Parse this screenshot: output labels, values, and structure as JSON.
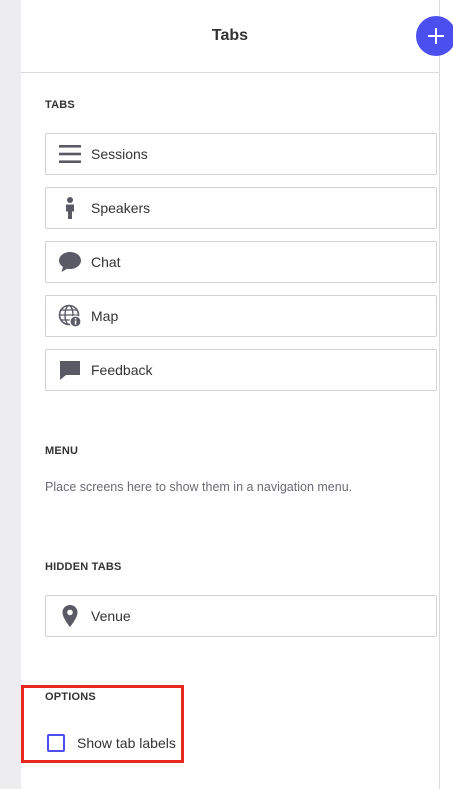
{
  "header": {
    "title": "Tabs"
  },
  "sections": {
    "tabs_label": "TABS",
    "menu_label": "MENU",
    "menu_hint": "Place screens here to show them in a navigation menu.",
    "hidden_label": "HIDDEN TABS",
    "options_label": "OPTIONS"
  },
  "tabs": [
    {
      "label": "Sessions",
      "icon": "list-icon"
    },
    {
      "label": "Speakers",
      "icon": "person-icon"
    },
    {
      "label": "Chat",
      "icon": "chat-bubble-icon"
    },
    {
      "label": "Map",
      "icon": "globe-info-icon"
    },
    {
      "label": "Feedback",
      "icon": "feedback-icon"
    }
  ],
  "hidden_tabs": [
    {
      "label": "Venue",
      "icon": "location-pin-icon"
    }
  ],
  "options": {
    "show_tab_labels": "Show tab labels",
    "show_tab_labels_checked": false
  },
  "colors": {
    "accent": "#4b4ff0",
    "highlight": "#e8261c",
    "icon": "#5a5a66"
  }
}
